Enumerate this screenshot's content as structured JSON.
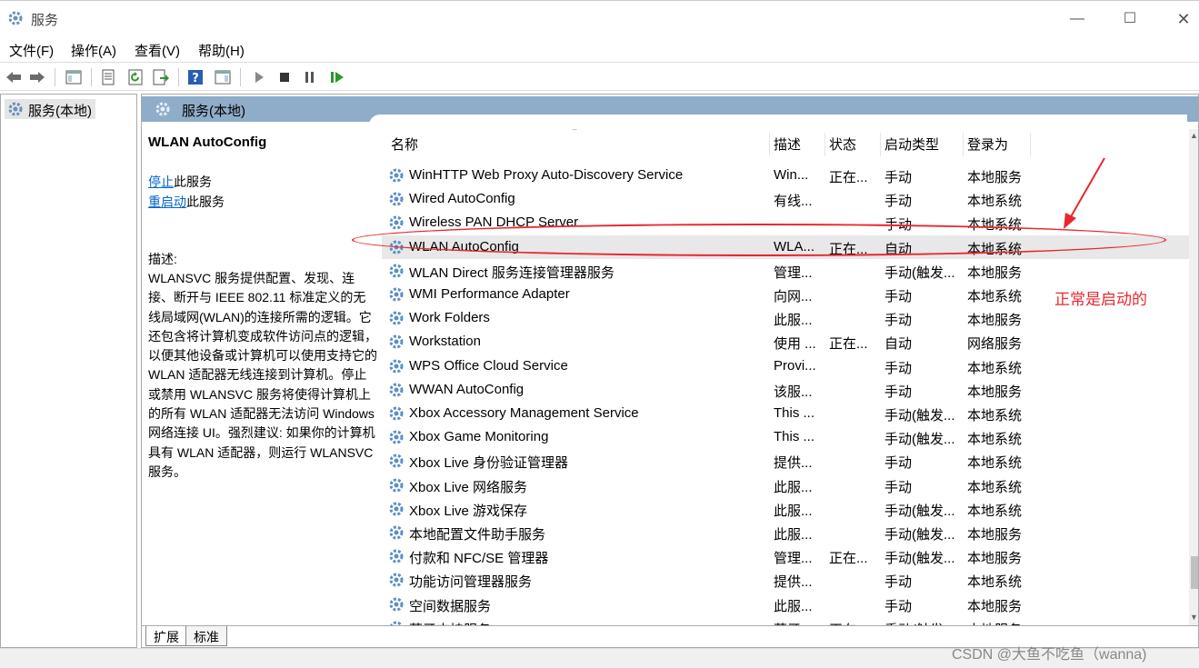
{
  "window": {
    "title": "服务",
    "minimize_glyph": "—",
    "maximize_glyph": "☐",
    "close_glyph": "✕"
  },
  "menu": {
    "file": "文件(F)",
    "action": "操作(A)",
    "view": "查看(V)",
    "help": "帮助(H)"
  },
  "tree": {
    "root_label": "服务(本地)"
  },
  "pane": {
    "header_title": "服务(本地)"
  },
  "details": {
    "service_name": "WLAN AutoConfig",
    "stop_link": "停止",
    "stop_suffix": "此服务",
    "restart_link": "重启动",
    "restart_suffix": "此服务",
    "description_label": "描述:",
    "description_text": "WLANSVC 服务提供配置、发现、连接、断开与 IEEE 802.11 标准定义的无线局域网(WLAN)的连接所需的逻辑。它还包含将计算机变成软件访问点的逻辑，以便其他设备或计算机可以使用支持它的 WLAN 适配器无线连接到计算机。停止或禁用 WLANSVC 服务将使得计算机上的所有 WLAN 适配器无法访问 Windows 网络连接 UI。强烈建议: 如果你的计算机具有 WLAN 适配器，则运行 WLANSVC 服务。"
  },
  "columns": {
    "name": "名称",
    "description": "描述",
    "status": "状态",
    "startup_type": "启动类型",
    "log_on_as": "登录为",
    "sort_glyph": "⌃"
  },
  "rows": [
    {
      "name": "WinHTTP Web Proxy Auto-Discovery Service",
      "desc": "Win...",
      "state": "正在...",
      "start": "手动",
      "logon": "本地服务"
    },
    {
      "name": "Wired AutoConfig",
      "desc": "有线...",
      "state": "",
      "start": "手动",
      "logon": "本地系统"
    },
    {
      "name": "Wireless PAN DHCP Server",
      "desc": "",
      "state": "",
      "start": "手动",
      "logon": "本地系统"
    },
    {
      "name": "WLAN AutoConfig",
      "desc": "WLA...",
      "state": "正在...",
      "start": "自动",
      "logon": "本地系统"
    },
    {
      "name": "WLAN Direct 服务连接管理器服务",
      "desc": "管理...",
      "state": "",
      "start": "手动(触发...",
      "logon": "本地服务"
    },
    {
      "name": "WMI Performance Adapter",
      "desc": "向网...",
      "state": "",
      "start": "手动",
      "logon": "本地系统"
    },
    {
      "name": "Work Folders",
      "desc": "此服...",
      "state": "",
      "start": "手动",
      "logon": "本地服务"
    },
    {
      "name": "Workstation",
      "desc": "使用 ...",
      "state": "正在...",
      "start": "自动",
      "logon": "网络服务"
    },
    {
      "name": "WPS Office Cloud Service",
      "desc": "Provi...",
      "state": "",
      "start": "手动",
      "logon": "本地系统"
    },
    {
      "name": "WWAN AutoConfig",
      "desc": "该服...",
      "state": "",
      "start": "手动",
      "logon": "本地服务"
    },
    {
      "name": "Xbox Accessory Management Service",
      "desc": "This ...",
      "state": "",
      "start": "手动(触发...",
      "logon": "本地系统"
    },
    {
      "name": "Xbox Game Monitoring",
      "desc": "This ...",
      "state": "",
      "start": "手动(触发...",
      "logon": "本地系统"
    },
    {
      "name": "Xbox Live 身份验证管理器",
      "desc": "提供...",
      "state": "",
      "start": "手动",
      "logon": "本地系统"
    },
    {
      "name": "Xbox Live 网络服务",
      "desc": "此服...",
      "state": "",
      "start": "手动",
      "logon": "本地系统"
    },
    {
      "name": "Xbox Live 游戏保存",
      "desc": "此服...",
      "state": "",
      "start": "手动(触发...",
      "logon": "本地系统"
    },
    {
      "name": "本地配置文件助手服务",
      "desc": "此服...",
      "state": "",
      "start": "手动(触发...",
      "logon": "本地服务"
    },
    {
      "name": "付款和 NFC/SE 管理器",
      "desc": "管理...",
      "state": "正在...",
      "start": "手动(触发...",
      "logon": "本地服务"
    },
    {
      "name": "功能访问管理器服务",
      "desc": "提供...",
      "state": "",
      "start": "手动",
      "logon": "本地系统"
    },
    {
      "name": "空间数据服务",
      "desc": "此服...",
      "state": "",
      "start": "手动",
      "logon": "本地服务"
    },
    {
      "name": "蓝牙支持服务",
      "desc": "蓝牙...",
      "state": "正在...",
      "start": "手动(触发...",
      "logon": "本地服务"
    }
  ],
  "selected_row": "WLAN AutoConfig",
  "tabs": {
    "extended": "扩展",
    "standard": "标准"
  },
  "annotation": {
    "text": "正常是启动的",
    "color": "#e8282e"
  },
  "watermark": "CSDN @大鱼不吃鱼（wanna)",
  "colors": {
    "pane_header": "#8facc9",
    "link": "#0066cc",
    "gear": "#5a8fc9"
  }
}
